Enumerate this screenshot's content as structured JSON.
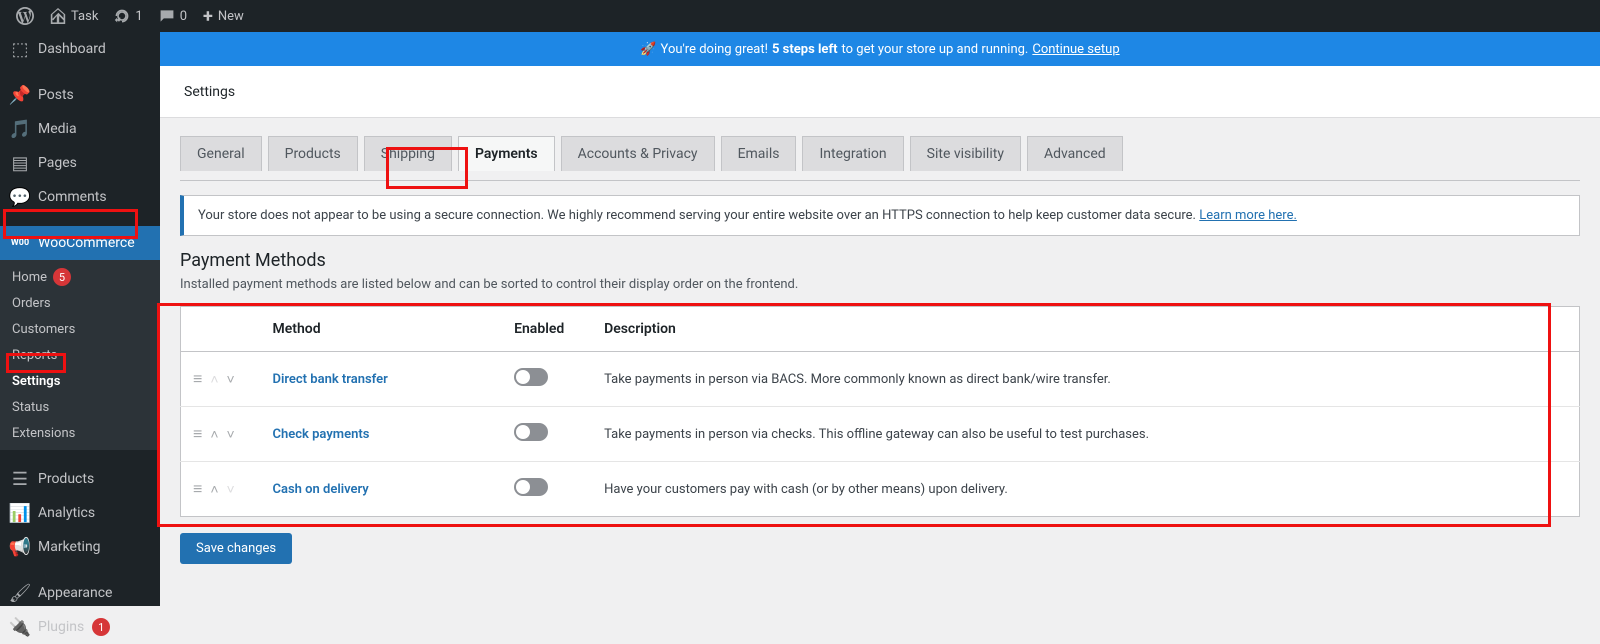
{
  "adminbar": {
    "site": "Task",
    "updates": "1",
    "comments": "0",
    "new": "New"
  },
  "sidebar": {
    "dashboard": "Dashboard",
    "posts": "Posts",
    "media": "Media",
    "pages": "Pages",
    "comments": "Comments",
    "woocommerce": "WooCommerce",
    "wc_home": "Home",
    "wc_home_badge": "5",
    "wc_orders": "Orders",
    "wc_customers": "Customers",
    "wc_reports": "Reports",
    "wc_settings": "Settings",
    "wc_status": "Status",
    "wc_extensions": "Extensions",
    "products": "Products",
    "analytics": "Analytics",
    "marketing": "Marketing",
    "appearance": "Appearance",
    "plugins": "Plugins",
    "plugins_badge": "1"
  },
  "banner": {
    "prefix": "You're doing great!",
    "bold": "5 steps left",
    "suffix": "to get your store up and running.",
    "link": "Continue setup"
  },
  "header": {
    "title": "Settings"
  },
  "tabs": {
    "general": "General",
    "products": "Products",
    "shipping": "Shipping",
    "payments": "Payments",
    "accounts": "Accounts & Privacy",
    "emails": "Emails",
    "integration": "Integration",
    "visibility": "Site visibility",
    "advanced": "Advanced"
  },
  "notice": {
    "text": "Your store does not appear to be using a secure connection. We highly recommend serving your entire website over an HTTPS connection to help keep customer data secure.",
    "link": "Learn more here."
  },
  "section": {
    "title": "Payment Methods",
    "desc": "Installed payment methods are listed below and can be sorted to control their display order on the frontend."
  },
  "table": {
    "col_method": "Method",
    "col_enabled": "Enabled",
    "col_description": "Description",
    "rows": [
      {
        "name": "Direct bank transfer",
        "desc": "Take payments in person via BACS. More commonly known as direct bank/wire transfer."
      },
      {
        "name": "Check payments",
        "desc": "Take payments in person via checks. This offline gateway can also be useful to test purchases."
      },
      {
        "name": "Cash on delivery",
        "desc": "Have your customers pay with cash (or by other means) upon delivery."
      }
    ]
  },
  "save": "Save changes"
}
